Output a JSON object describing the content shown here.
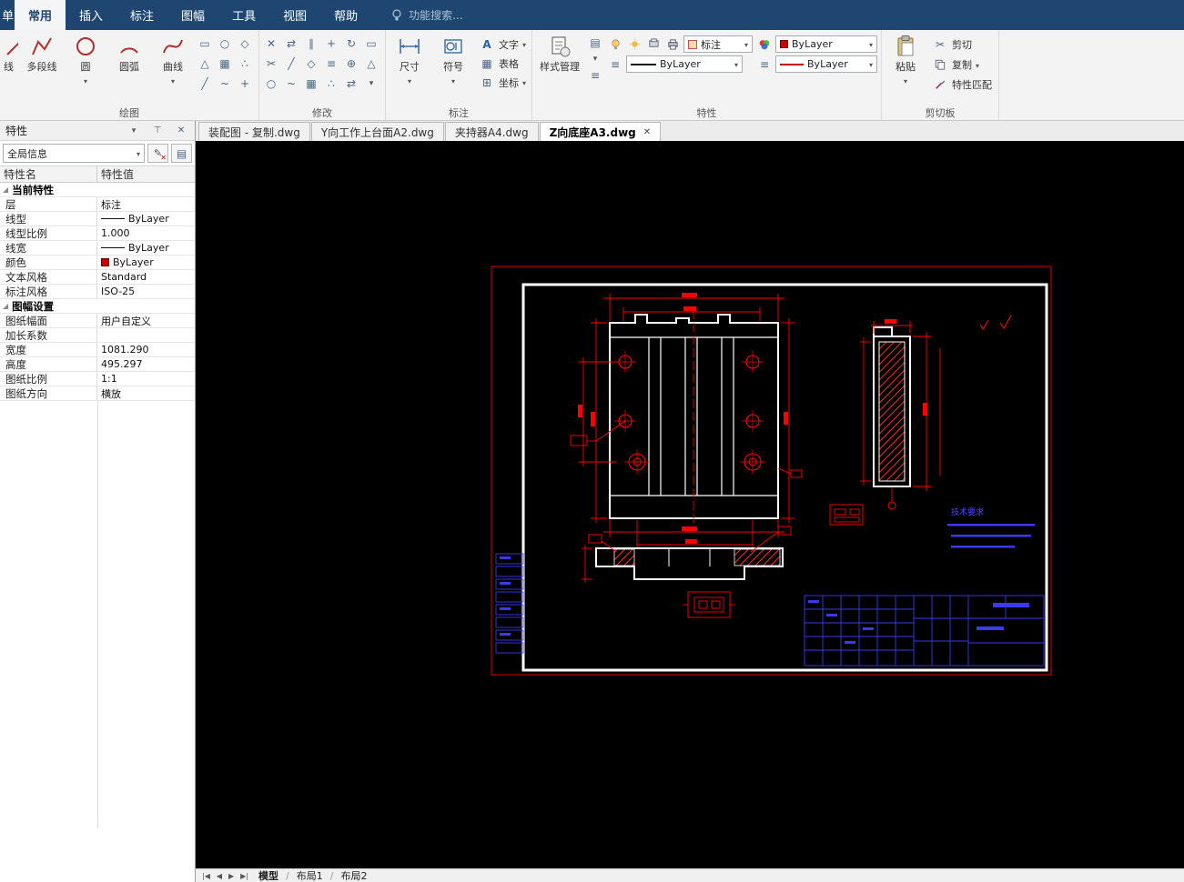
{
  "colors": {
    "accent": "#1e4670",
    "cad_red": "#ff0000",
    "cad_white": "#ffffff",
    "cad_blue": "#3a3af2",
    "color_swatch": "#cc0000"
  },
  "menubar": {
    "partial_item": "单",
    "items": [
      {
        "label": "常用"
      },
      {
        "label": "插入"
      },
      {
        "label": "标注"
      },
      {
        "label": "图幅"
      },
      {
        "label": "工具"
      },
      {
        "label": "视图"
      },
      {
        "label": "帮助"
      }
    ],
    "active_item": "常用",
    "search_text": "功能搜索..."
  },
  "ribbon": {
    "sections": {
      "draw": {
        "label": "绘图",
        "tools": [
          {
            "label": "线"
          },
          {
            "label": "多段线"
          },
          {
            "label": "圆"
          },
          {
            "label": "圆弧"
          },
          {
            "label": "曲线"
          }
        ]
      },
      "modify": {
        "label": "修改"
      },
      "dimension": {
        "label": "标注",
        "dim": "尺寸",
        "symbol": "符号",
        "text": "文字",
        "table": "表格",
        "coord": "坐标"
      },
      "properties": {
        "label": "特性",
        "style_manager": "样式管理",
        "dim_style": "标注",
        "linetype": "ByLayer",
        "layer": "ByLayer",
        "lineweight": "ByLayer"
      },
      "clipboard": {
        "label": "剪切板",
        "paste": "粘贴",
        "cut": "剪切",
        "copy": "复制",
        "match": "特性匹配"
      }
    }
  },
  "doc_tabs": [
    {
      "label": "装配图 - 复制.dwg"
    },
    {
      "label": "Y向工作上台面A2.dwg"
    },
    {
      "label": "夹持器A4.dwg"
    },
    {
      "label": "Z向底座A3.dwg"
    }
  ],
  "active_doc_tab": "Z向底座A3.dwg",
  "panel": {
    "title": "特性",
    "scope": "全局信息",
    "columns": {
      "name": "特性名",
      "value": "特性值"
    },
    "groups": [
      {
        "label": "当前特性",
        "rows": [
          {
            "name": "层",
            "value": "标注"
          },
          {
            "name": "线型",
            "value": "ByLayer"
          },
          {
            "name": "线型比例",
            "value": "1.000"
          },
          {
            "name": "线宽",
            "value": "ByLayer"
          },
          {
            "name": "颜色",
            "value": "ByLayer"
          },
          {
            "name": "文本风格",
            "value": "Standard"
          },
          {
            "name": "标注风格",
            "value": "ISO-25"
          }
        ]
      },
      {
        "label": "图幅设置",
        "rows": [
          {
            "name": "图纸幅面",
            "value": "用户自定义"
          },
          {
            "name": "加长系数",
            "value": ""
          },
          {
            "name": "宽度",
            "value": "1081.290"
          },
          {
            "name": "高度",
            "value": "495.297"
          },
          {
            "name": "图纸比例",
            "value": "1:1"
          },
          {
            "name": "图纸方向",
            "value": "横放"
          }
        ]
      }
    ]
  },
  "canvas": {
    "tech_note_heading": "技术要求"
  },
  "bottom_bar": {
    "tabs": [
      {
        "label": "模型"
      },
      {
        "label": "布局1"
      },
      {
        "label": "布局2"
      }
    ],
    "active_tab": "模型"
  }
}
